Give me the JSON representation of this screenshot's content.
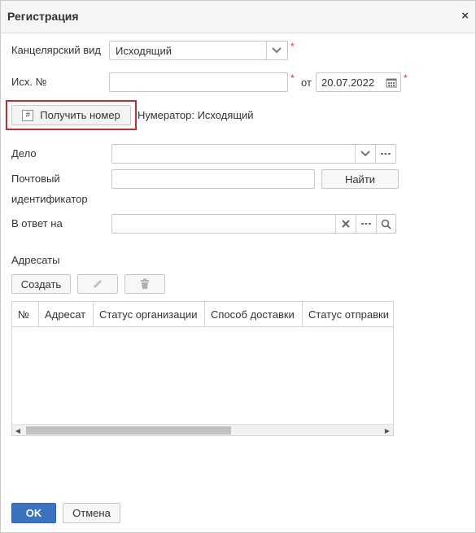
{
  "dialog": {
    "title": "Регистрация",
    "close": "×"
  },
  "form": {
    "office_view_label": "Канцелярский вид",
    "office_view_value": "Исходящий",
    "out_num_label": "Исх. №",
    "out_num_value": "",
    "from_label": "от",
    "date_value": "20.07.2022",
    "get_number_button": "Получить номер",
    "numerator_text": "Нумератор: Исходящий",
    "case_label": "Дело",
    "case_value": "",
    "postal_id_label_line1": "Почтовый",
    "postal_id_label_line2": "идентификатор",
    "postal_id_value": "",
    "find_button": "Найти",
    "reply_to_label": "В ответ на",
    "reply_to_value": "",
    "required_mark": "*"
  },
  "recipients": {
    "section_label": "Адресаты",
    "create_button": "Создать",
    "columns": [
      "№",
      "Адресат",
      "Статус организации",
      "Способ доставки",
      "Статус отправки"
    ]
  },
  "footer": {
    "ok": "OK",
    "cancel": "Отмена"
  },
  "colors": {
    "accent": "#3a73c0",
    "required": "#e03030",
    "highlight_box": "#d0282e"
  }
}
